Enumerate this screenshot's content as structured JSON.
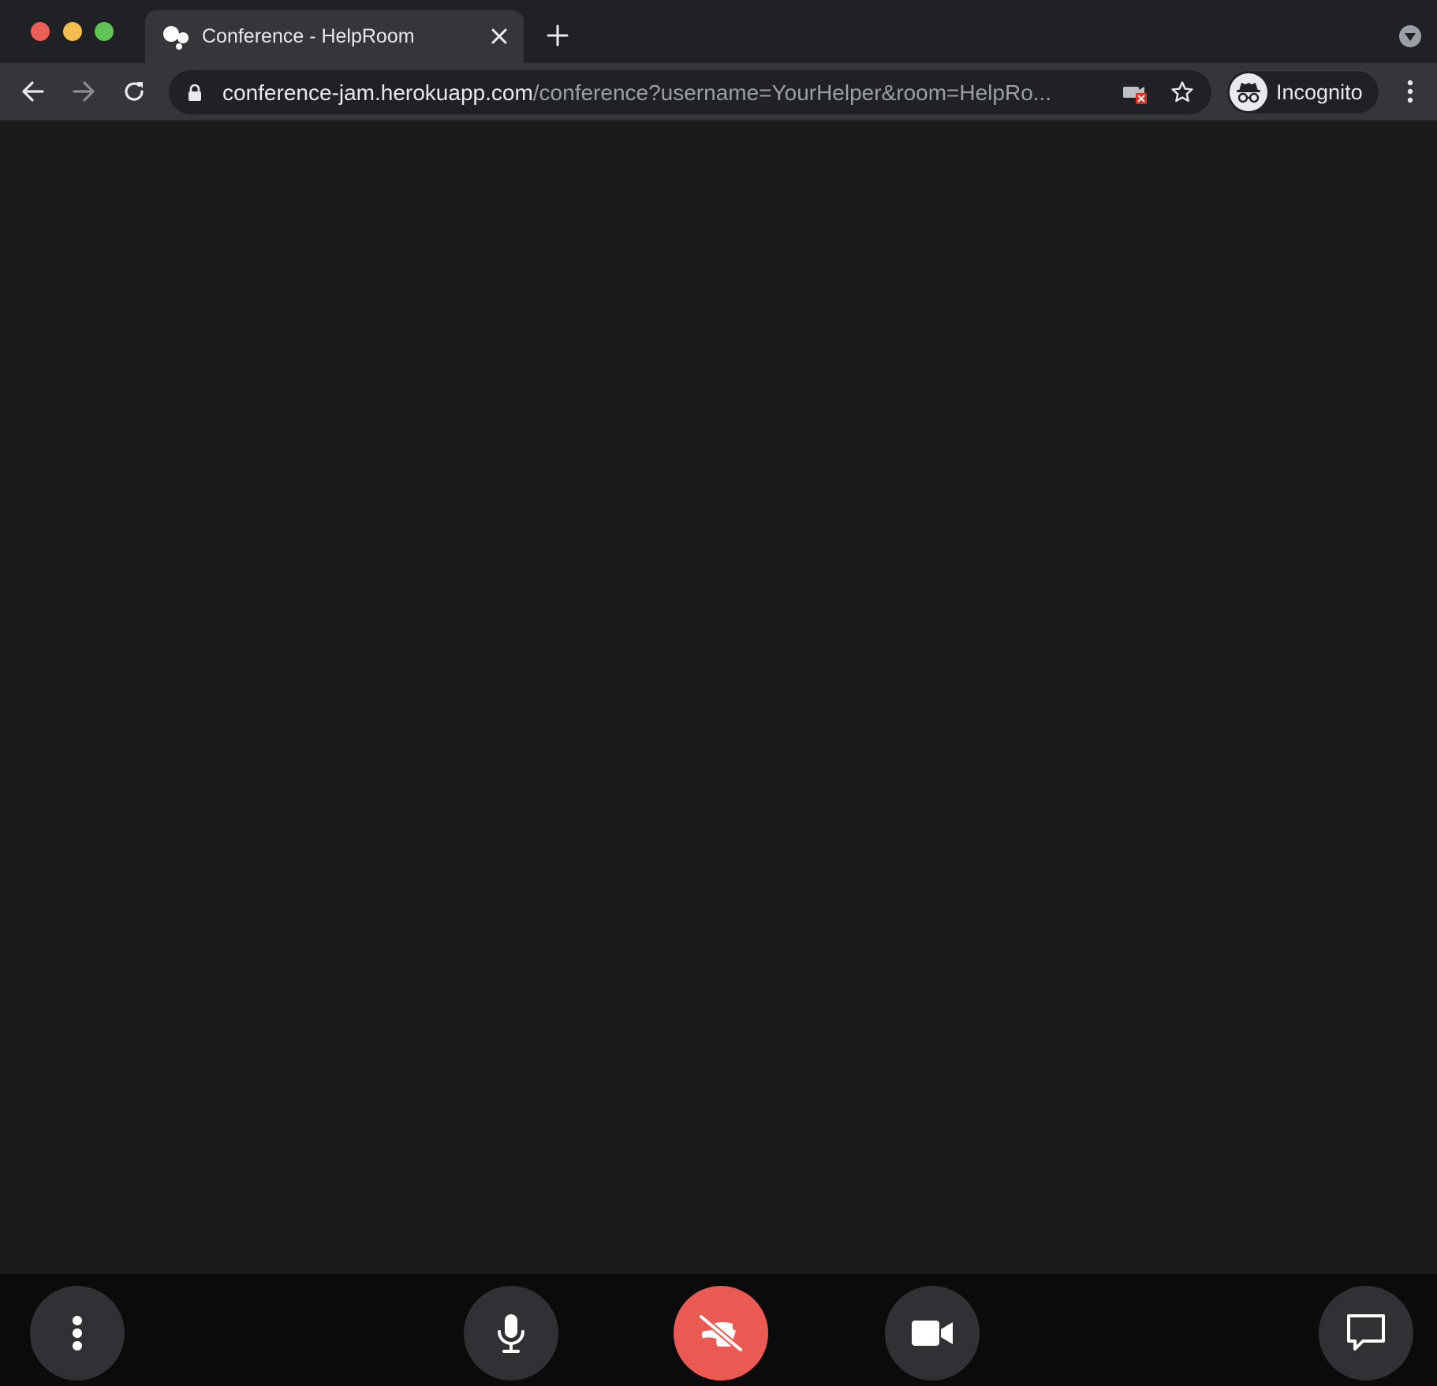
{
  "browser": {
    "tab": {
      "title": "Conference - HelpRoom",
      "favicon": "conference-logo-icon"
    },
    "address_bar": {
      "host": "conference-jam.herokuapp.com",
      "path": "/conference?username=YourHelper&room=HelpRo..."
    },
    "profile": {
      "label": "Incognito",
      "icon": "incognito-icon"
    }
  },
  "controls": {
    "more": "more-vertical-icon",
    "microphone": "microphone-icon",
    "hangup": "hangup-icon",
    "camera": "video-camera-icon",
    "chat": "chat-icon"
  },
  "colors": {
    "hangup": "#ea5a52",
    "control_bg": "#303134",
    "stage_bg": "#1b1b1c",
    "window_close": "#ec5f57",
    "window_minimize": "#f4bd4f",
    "window_maximize": "#5fc453"
  }
}
